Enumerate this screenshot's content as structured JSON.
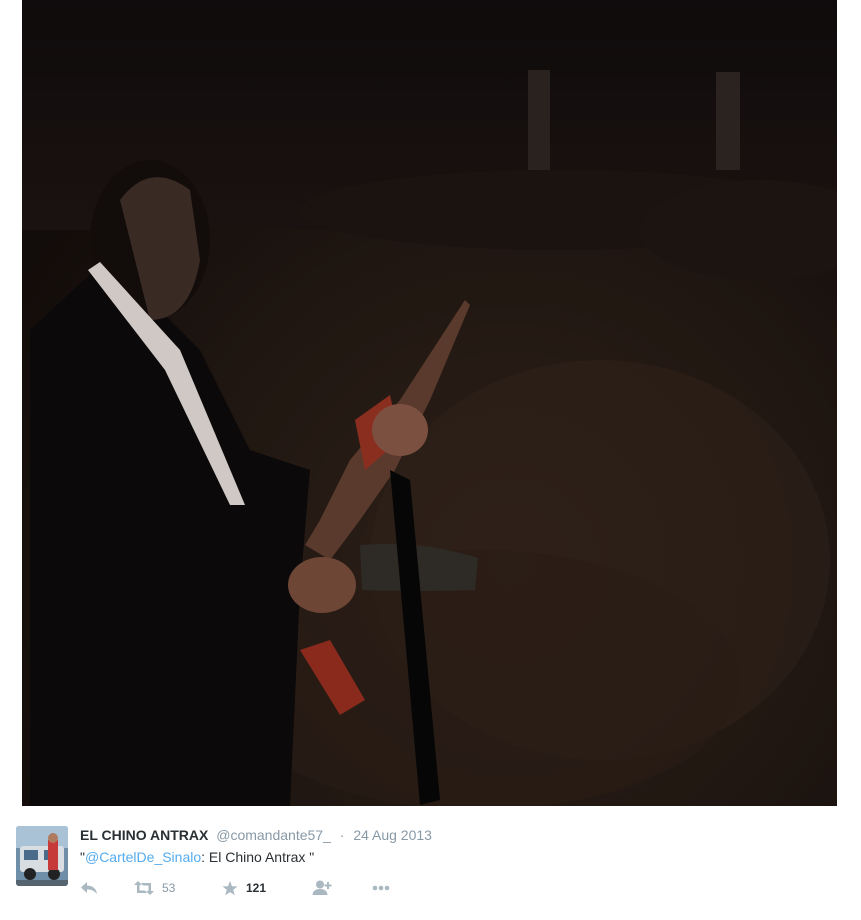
{
  "tweet": {
    "display_name": "EL CHINO ANTRAX",
    "handle": "@comandante57_",
    "separator": "·",
    "date": "24 Aug 2013",
    "text_open_quote": "\"",
    "mention": "@CartelDe_Sinalo",
    "text_rest": ": El Chino Antrax \"",
    "retweet_count": "53",
    "favorite_count": "121"
  },
  "icons": {
    "reply": "reply-icon",
    "retweet": "retweet-icon",
    "favorite": "star-icon",
    "follow": "follow-icon",
    "more": "more-icon"
  },
  "colors": {
    "link": "#55acee",
    "name": "#292f33",
    "meta": "#8899a6",
    "action_icon": "#aab8c2"
  }
}
